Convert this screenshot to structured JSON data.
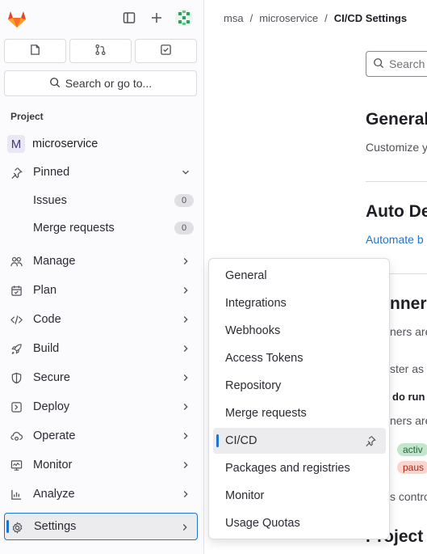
{
  "breadcrumb": [
    "msa",
    "/",
    "microservice",
    "/",
    "CI/CD Settings"
  ],
  "topbar": {
    "icons": [
      "gitlab-logo",
      "sidebar-toggle-icon",
      "plus-icon",
      "user-avatar"
    ]
  },
  "quick_actions": [
    "issues-icon",
    "merge-request-icon",
    "todo-icon"
  ],
  "search": {
    "label": "Search or go to..."
  },
  "sidebar": {
    "section_label": "Project",
    "project": {
      "initial": "M",
      "name": "microservice"
    },
    "pinned": {
      "label": "Pinned",
      "items": [
        {
          "label": "Issues",
          "count": "0"
        },
        {
          "label": "Merge requests",
          "count": "0"
        }
      ]
    },
    "items": [
      {
        "label": "Manage",
        "icon": "users-icon"
      },
      {
        "label": "Plan",
        "icon": "calendar-icon"
      },
      {
        "label": "Code",
        "icon": "code-icon"
      },
      {
        "label": "Build",
        "icon": "rocket-icon"
      },
      {
        "label": "Secure",
        "icon": "shield-icon"
      },
      {
        "label": "Deploy",
        "icon": "deploy-icon"
      },
      {
        "label": "Operate",
        "icon": "cloud-gear-icon"
      },
      {
        "label": "Monitor",
        "icon": "monitor-icon"
      },
      {
        "label": "Analyze",
        "icon": "chart-icon"
      },
      {
        "label": "Settings",
        "icon": "gear-icon"
      }
    ]
  },
  "flyout": {
    "items": [
      {
        "label": "General"
      },
      {
        "label": "Integrations"
      },
      {
        "label": "Webhooks"
      },
      {
        "label": "Access Tokens"
      },
      {
        "label": "Repository"
      },
      {
        "label": "Merge requests"
      },
      {
        "label": "CI/CD"
      },
      {
        "label": "Packages and registries"
      },
      {
        "label": "Monitor"
      },
      {
        "label": "Usage Quotas"
      }
    ]
  },
  "main": {
    "search_placeholder": "Search",
    "general_title": "General",
    "general_desc": "Customize y",
    "auto_devops_title": "Auto De",
    "auto_devops_link": "Automate b",
    "runners_title": "nners",
    "runners_frag1": "ners are",
    "runners_frag2": "ster as",
    "runners_frag3": "do run",
    "runners_frag4": "ners are",
    "badge_active": "activ",
    "badge_paused": "paus",
    "runners_frag5": "s contro",
    "project_frag": "Project r"
  },
  "colors": {
    "accent": "#1f75cb",
    "badge_active_bg": "#c3e6cd",
    "badge_paused_bg": "#fdd4cd"
  }
}
